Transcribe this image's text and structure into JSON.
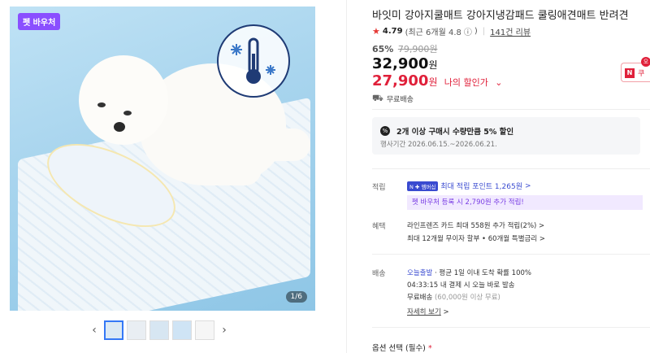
{
  "gallery": {
    "badge": "펫 바우처",
    "counter": "1/6",
    "prev_icon": "chevron-left-icon",
    "next_icon": "chevron-right-icon",
    "thumbnail_count": 5
  },
  "product": {
    "title": "바잇미 강아지쿨매트 강아지냉감패드 쿨링애견매트 반려견",
    "rating": "4.79",
    "rating_recent": "(최근 6개월 4.8",
    "rating_info_icon": "ⓘ",
    "rating_close": ")",
    "review_count": "141건 리뷰",
    "discount_pct": "65%",
    "original_price": "79,900원",
    "sale_price": "32,900",
    "sale_unit": "원",
    "my_price": "27,900",
    "my_unit": "원",
    "my_price_label": "나의 할인가",
    "my_price_chevron": "⌄",
    "shipping": "무료배송"
  },
  "coupon_tab": {
    "badge": "오",
    "n": "N",
    "text": "쿠"
  },
  "promo": {
    "icon": "%",
    "title": "2개 이상 구매시 수량만큼 5% 할인",
    "period": "행사기간 2026.06.15.~2026.06.21."
  },
  "points": {
    "label": "적립",
    "npay": "N ✚ 멤버십",
    "max_point": "최대 적립 포인트 1,265원",
    "max_point_chevron": ">",
    "pet_coupon": "펫 바우처 등록 시 2,790원 추가 적립!"
  },
  "benefits": {
    "label": "혜택",
    "line1": "라인프렌즈 카드 최대 558원 추가 적립(2%) >",
    "line2": "최대 12개월 무이자 할부 • 60개월 특별금리 >"
  },
  "delivery": {
    "label": "배송",
    "today": "오늘출발",
    "today_info": "· 평균 1일 이내 도착 확률 100%",
    "cutoff": "04:33:15  내 결제 시 오늘 바로 발송",
    "free": "무료배송",
    "free_condition": "(60,000원 이상 무료)",
    "detail_link": "자세히 보기",
    "detail_chevron": ">"
  },
  "options": {
    "label": "옵션 선택 (필수)",
    "required_mark": "*"
  },
  "colors": {
    "accent_red": "#e0203a",
    "npay_blue": "#3a4bd0",
    "pet_purple": "#8a4fff"
  }
}
